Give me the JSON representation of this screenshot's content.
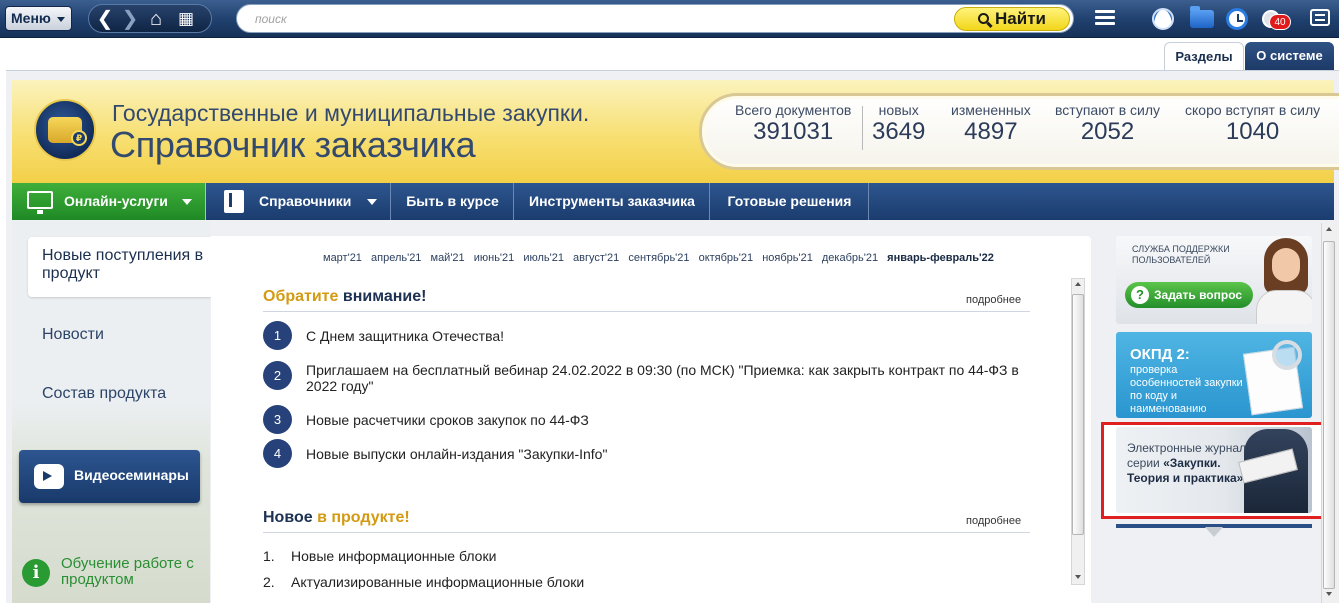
{
  "topbar": {
    "menu_label": "Меню",
    "search_placeholder": "поиск",
    "find_label": "Найти",
    "notifications_count": "40"
  },
  "tabs": [
    {
      "label": "Разделы",
      "active": true
    },
    {
      "label": "О системе",
      "active": false
    }
  ],
  "header": {
    "brand_line1": "Государственные и муниципальные закупки.",
    "brand_line2": "Справочник заказчика",
    "logo_coin": "₽",
    "stats": [
      {
        "label": "Всего документов",
        "value": "391031"
      },
      {
        "label": "новых",
        "value": "3649"
      },
      {
        "label": "измененных",
        "value": "4897"
      },
      {
        "label": "вступают в силу",
        "value": "2052"
      },
      {
        "label": "скоро вступят в силу",
        "value": "1040"
      }
    ]
  },
  "mainnav": {
    "online": "Онлайн-услуги",
    "spravochniki": "Справочники",
    "byt_v_kurse": "Быть в курсе",
    "instrumenty": "Инструменты заказчика",
    "gotovye": "Готовые решения"
  },
  "leftpanel": {
    "active_item": "Новые поступления в продукт",
    "items": [
      "Новости",
      "Состав продукта"
    ],
    "video_button": "Видеосеминары",
    "learn_link": "Обучение работе с продуктом"
  },
  "content": {
    "months": [
      "март'21",
      "апрель'21",
      "май'21",
      "июнь'21",
      "июль'21",
      "август'21",
      "сентябрь'21",
      "октябрь'21",
      "ноябрь'21",
      "декабрь'21"
    ],
    "current_month": "январь-февраль'22",
    "attention": {
      "title_part1": "Обратите",
      "title_part2": " внимание!",
      "more": "подробнее",
      "items": [
        "С Днем защитника Отечества!",
        "Приглашаем на бесплатный вебинар 24.02.2022 в 09:30 (по МСК) \"Приемка: как закрыть контракт по 44-ФЗ в 2022 году\"",
        "Новые расчетчики сроков закупок по 44-ФЗ",
        "Новые выпуски онлайн-издания \"Закупки-Info\""
      ],
      "numbers": [
        "1",
        "2",
        "3",
        "4"
      ]
    },
    "new_in_product": {
      "title_part1": "Новое",
      "title_part2": " в продукте!",
      "more": "подробнее",
      "numbers": [
        "1.",
        "2."
      ],
      "items": [
        "Новые информационные блоки",
        "Актуализированные информационные блоки"
      ]
    }
  },
  "right": {
    "support_text": "СЛУЖБА ПОДДЕРЖКИ ПОЛЬЗОВАТЕЛЕЙ",
    "ask_button": "Задать вопрос",
    "okpd_title": "ОКПД 2:",
    "okpd_text": "проверка особенностей закупки по коду и наименованию",
    "journal_text1": "Электронные журналы серии",
    "journal_text2": "«Закупки. Теория и практика»"
  },
  "colors": {
    "navy": "#1b3c6e",
    "accent_yellow": "#d39a12",
    "green": "#2a9a32",
    "highlight_red": "#e02020"
  }
}
